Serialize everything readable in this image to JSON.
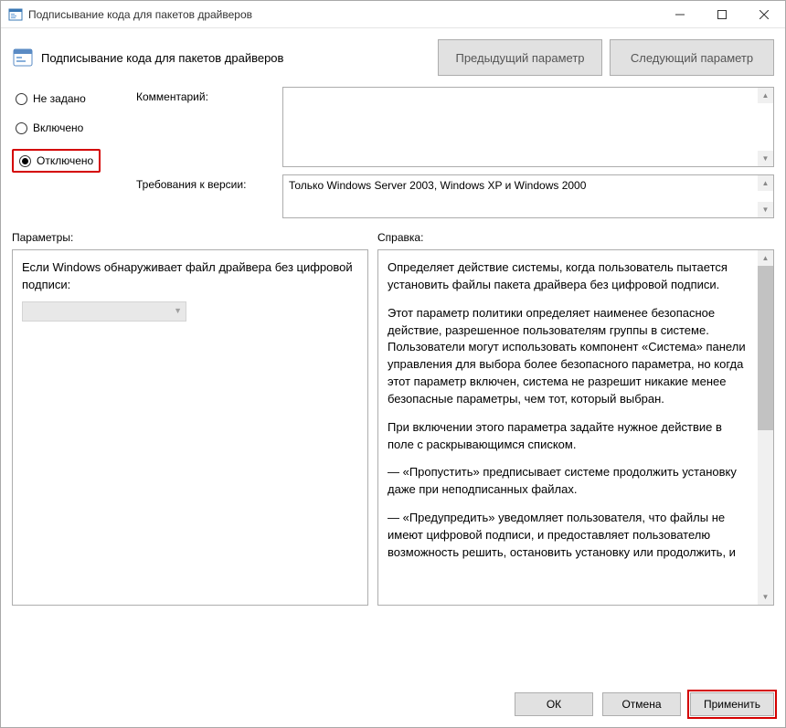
{
  "window": {
    "title": "Подписывание кода для пакетов драйверов"
  },
  "header": {
    "title": "Подписывание кода для пакетов драйверов",
    "prev_btn": "Предыдущий параметр",
    "next_btn": "Следующий параметр"
  },
  "radios": {
    "not_configured": "Не задано",
    "enabled": "Включено",
    "disabled": "Отключено",
    "selected": "disabled"
  },
  "fields": {
    "comment_label": "Комментарий:",
    "comment_value": "",
    "version_label": "Требования к версии:",
    "version_value": "Только Windows Server 2003, Windows XP и Windows 2000"
  },
  "mid": {
    "params_label": "Параметры:",
    "help_label": "Справка:"
  },
  "params": {
    "text": "Если Windows обнаруживает файл драйвера без цифровой подписи:"
  },
  "help": {
    "p1": "Определяет действие системы, когда пользователь пытается установить файлы пакета драйвера без цифровой подписи.",
    "p2": "Этот параметр политики определяет наименее безопасное действие, разрешенное пользователям группы в системе. Пользователи могут использовать компонент «Система» панели управления для выбора более безопасного параметра, но когда этот параметр включен, система не разрешит никакие менее безопасные параметры, чем тот, который выбран.",
    "p3": "При включении этого параметра задайте нужное действие в поле с раскрывающимся списком.",
    "p4": "—   «Пропустить» предписывает системе продолжить установку даже при неподписанных файлах.",
    "p5": "—   «Предупредить» уведомляет пользователя, что файлы не имеют цифровой подписи, и предоставляет пользователю возможность решить, остановить установку или продолжить, и"
  },
  "footer": {
    "ok": "ОК",
    "cancel": "Отмена",
    "apply": "Применить"
  }
}
